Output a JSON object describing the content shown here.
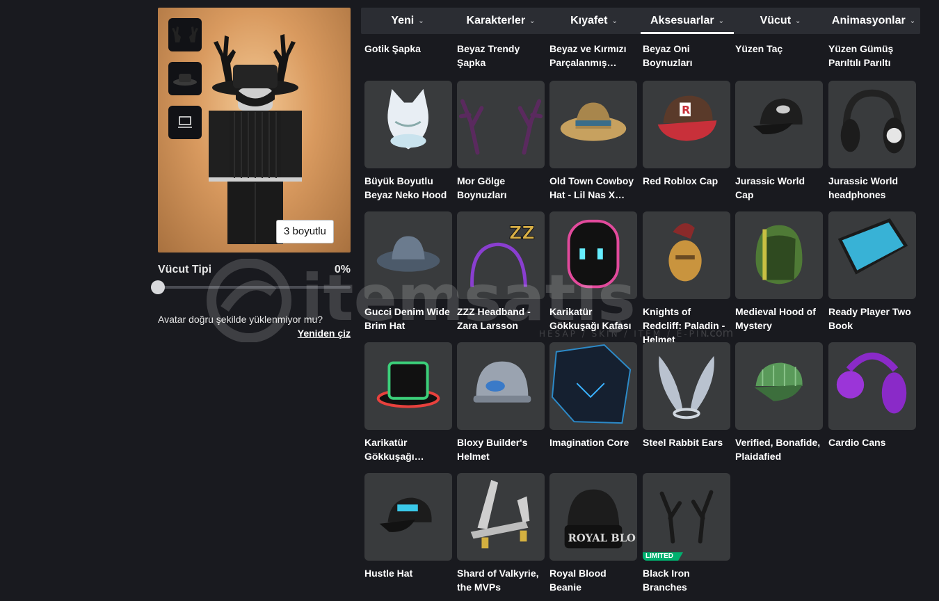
{
  "avatar": {
    "button_3d": "3 boyutlu",
    "body_type_label": "Vücut Tipi",
    "body_type_value": "0%",
    "body_type_fraction": 0,
    "note": "Avatar doğru şekilde yüklenmiyor mu?",
    "redraw_link": "Yeniden çiz",
    "thumbnails": [
      "antlers-icon",
      "hat-icon",
      "monitor-icon"
    ]
  },
  "tabs": [
    {
      "label": "Yeni",
      "active": false
    },
    {
      "label": "Karakterler",
      "active": false
    },
    {
      "label": "Kıyafet",
      "active": false
    },
    {
      "label": "Aksesuarlar",
      "active": true
    },
    {
      "label": "Vücut",
      "active": false
    },
    {
      "label": "Animasyonlar",
      "active": false
    }
  ],
  "top_row": [
    "Gotik Şapka",
    "Beyaz Trendy Şapka",
    "Beyaz ve Kırmızı Parçalanmış…",
    "Beyaz Oni Boynuzları",
    "Yüzen Taç",
    "Yüzen Gümüş Parıltılı Parıltı"
  ],
  "items": [
    {
      "name": "Büyük Boyutlu Beyaz Neko Hood",
      "icon": "neko-hood-icon"
    },
    {
      "name": "Mor Gölge Boynuzları",
      "icon": "purple-antlers-icon"
    },
    {
      "name": "Old Town Cowboy Hat - Lil Nas X…",
      "icon": "cowboy-hat-icon"
    },
    {
      "name": "Red Roblox Cap",
      "icon": "red-cap-icon"
    },
    {
      "name": "Jurassic World Cap",
      "icon": "black-cap-icon"
    },
    {
      "name": "Jurassic World headphones",
      "icon": "headphones-icon"
    },
    {
      "name": "Gucci Denim Wide Brim Hat",
      "icon": "denim-hat-icon"
    },
    {
      "name": "ZZZ Headband - Zara Larsson",
      "icon": "zzz-headband-icon"
    },
    {
      "name": "Karikatür Gökkuşağı Kafası",
      "icon": "rainbow-head-icon"
    },
    {
      "name": "Knights of Redcliff: Paladin - Helmet",
      "icon": "paladin-helmet-icon"
    },
    {
      "name": "Medieval Hood of Mystery",
      "icon": "green-hood-icon"
    },
    {
      "name": "Ready Player Two Book",
      "icon": "book-icon"
    },
    {
      "name": "Karikatür Gökkuşağı…",
      "icon": "rainbow-tophat-icon"
    },
    {
      "name": "Bloxy Builder's Helmet",
      "icon": "builder-helmet-icon"
    },
    {
      "name": "Imagination Core",
      "icon": "imagination-core-icon"
    },
    {
      "name": "Steel Rabbit Ears",
      "icon": "rabbit-ears-icon"
    },
    {
      "name": "Verified, Bonafide, Plaidafied",
      "icon": "plaid-cap-icon"
    },
    {
      "name": "Cardio Cans",
      "icon": "purple-earmuffs-icon"
    },
    {
      "name": "Hustle Hat",
      "icon": "hustle-cap-icon"
    },
    {
      "name": "Shard of Valkyrie, the MVPs",
      "icon": "valkyrie-shard-icon"
    },
    {
      "name": "Royal Blood Beanie",
      "icon": "beanie-icon",
      "beanie_text": "ROYAL BLO"
    },
    {
      "name": "Black Iron Branches",
      "icon": "iron-branches-icon",
      "badge": "LIMITED"
    }
  ],
  "watermark": {
    "main": "itemsatış",
    "sub": "HESAP / SKIN / ITEM / E-PIN",
    "domain": ".com"
  },
  "colors": {
    "background": "#191a1f",
    "tile": "#393b3d",
    "tab_bar": "#2b2d33",
    "limited": "#00b06f"
  }
}
